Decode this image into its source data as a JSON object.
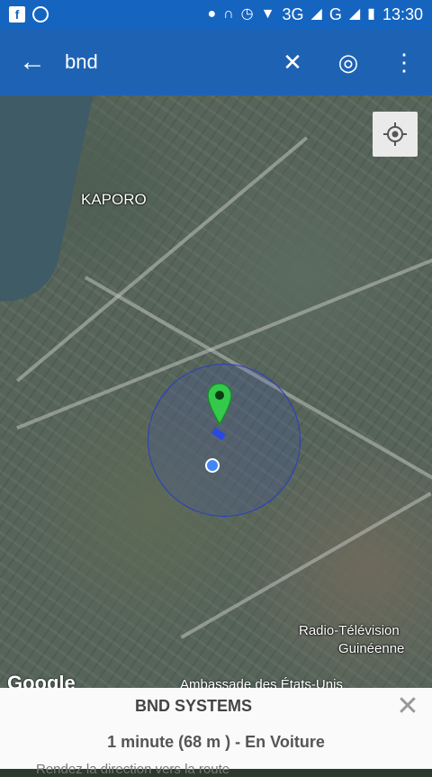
{
  "status": {
    "left_icons": [
      "facebook-icon",
      "whatsapp-icon"
    ],
    "right_icons": [
      "location-icon",
      "headset-icon",
      "alarm-icon",
      "wifi-icon"
    ],
    "network": "3G",
    "carrier2": "G",
    "time": "13:30"
  },
  "appbar": {
    "query": "bnd",
    "back_icon": "←",
    "clear_icon": "✕",
    "target_icon": "◎",
    "more_icon": "⋮"
  },
  "map": {
    "label_kaporo": "KAPORO",
    "label_radio": "Radio-Télévision",
    "label_radio2": "Guinéenne",
    "label_embassy": "Ambassade des États-Unis",
    "google": "Google"
  },
  "panel": {
    "title": "BND SYSTEMS",
    "route": "1 minute (68 m ) - En Voiture",
    "hint": "Rendez la direction vers la route",
    "close_icon": "✕"
  }
}
